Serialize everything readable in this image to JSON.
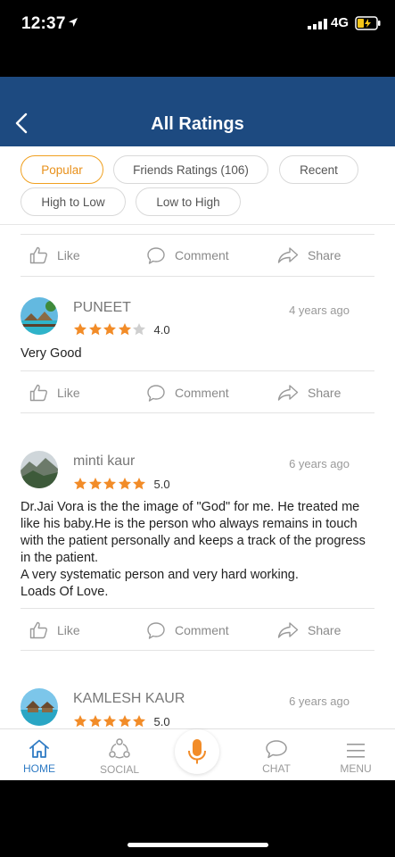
{
  "status_bar": {
    "time": "12:37",
    "network": "4G"
  },
  "header": {
    "title": "All Ratings"
  },
  "filters": [
    {
      "label": "Popular",
      "active": true
    },
    {
      "label": "Friends Ratings (106)",
      "active": false
    },
    {
      "label": "Recent",
      "active": false
    },
    {
      "label": "High to Low",
      "active": false
    },
    {
      "label": "Low to High",
      "active": false
    }
  ],
  "actions": {
    "like": "Like",
    "comment": "Comment",
    "share": "Share"
  },
  "reviews": [
    {
      "name": "PUNEET",
      "time": "4 years ago",
      "stars": 4,
      "rating": "4.0",
      "text": "Very Good"
    },
    {
      "name": "minti kaur",
      "time": "6 years ago",
      "stars": 5,
      "rating": "5.0",
      "text": "Dr.Jai Vora is the the image of \"God\" for me. He treated me like his baby.He is the person who always remains in touch with the patient personally and keeps a track of the progress in the patient.\nA very systematic person and very hard working.\nLoads Of Love."
    },
    {
      "name": "KAMLESH KAUR",
      "time": "6 years ago",
      "stars": 5,
      "rating": "5.0",
      "text": ""
    }
  ],
  "nav": {
    "home": "HOME",
    "social": "SOCIAL",
    "chat": "CHAT",
    "menu": "MENU"
  },
  "colors": {
    "header": "#1d4a80",
    "accent": "#f0a020",
    "star": "#f28c28",
    "nav_active": "#2f7bc4"
  }
}
